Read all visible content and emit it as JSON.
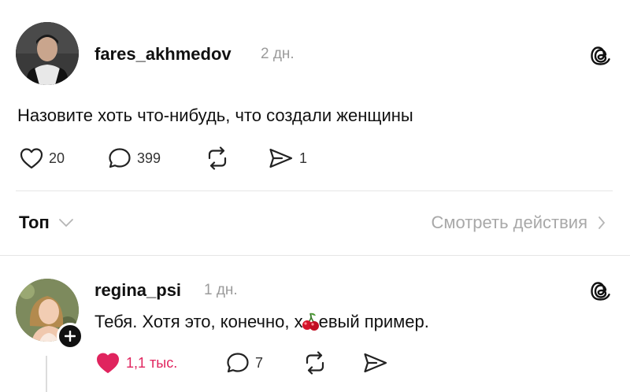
{
  "post": {
    "username": "fares_akhmedov",
    "time": "2 дн.",
    "text": "Назовите хоть что-нибудь, что создали женщины",
    "likes": "20",
    "replies": "399",
    "shares": "1"
  },
  "filter": {
    "sort_label": "Топ",
    "activity_label": "Смотреть действия"
  },
  "reply": {
    "username": "regina_psi",
    "time": "1 дн.",
    "text_before": "Тебя. Хотя это, конечно, х",
    "text_after": "евый пример.",
    "likes": "1,1 тыс.",
    "replies": "7"
  },
  "colors": {
    "like_active": "#e0245e",
    "muted": "#9b9b9b",
    "text": "#111111"
  },
  "icons": [
    "heart-icon",
    "comment-icon",
    "repost-icon",
    "share-icon",
    "threads-logo-icon",
    "chevron-down-icon",
    "chevron-right-icon",
    "plus-icon",
    "cherry-emoji"
  ]
}
